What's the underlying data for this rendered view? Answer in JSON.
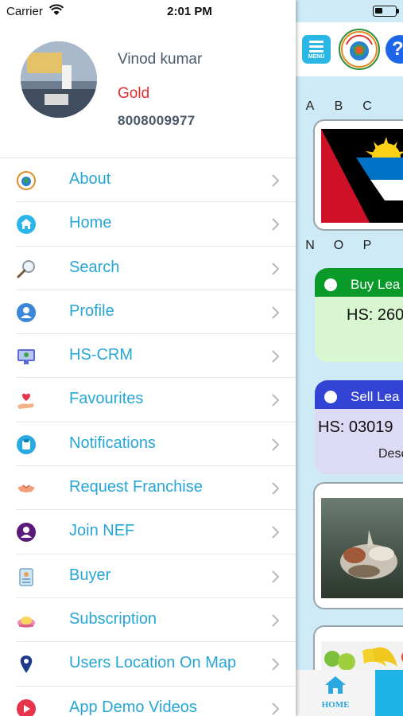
{
  "status_bar": {
    "carrier": "Carrier",
    "time": "2:01 PM"
  },
  "profile": {
    "name": "Vinod kumar",
    "tier": "Gold",
    "phone": "8008009977"
  },
  "menu": [
    {
      "label": "About",
      "icon": "about-icon"
    },
    {
      "label": "Home",
      "icon": "home-icon"
    },
    {
      "label": "Search",
      "icon": "search-icon"
    },
    {
      "label": "Profile",
      "icon": "profile-icon"
    },
    {
      "label": "HS-CRM",
      "icon": "crm-monitor-icon"
    },
    {
      "label": "Favourites",
      "icon": "heart-hand-icon"
    },
    {
      "label": "Notifications",
      "icon": "notification-icon"
    },
    {
      "label": "Request Franchise",
      "icon": "handshake-icon"
    },
    {
      "label": "Join NEF",
      "icon": "join-user-icon"
    },
    {
      "label": "Buyer",
      "icon": "buyer-id-icon"
    },
    {
      "label": "Subscription",
      "icon": "subscription-icon"
    },
    {
      "label": "Users Location On Map",
      "icon": "map-pin-icon"
    },
    {
      "label": "App Demo Videos",
      "icon": "play-icon"
    }
  ],
  "main": {
    "menu_button_label": "MENU",
    "help_button_label": "?",
    "alphabet_row_1": [
      "A",
      "B",
      "C"
    ],
    "alphabet_row_2": [
      "N",
      "O",
      "P"
    ],
    "buy_lead": {
      "title": "Buy Lea",
      "hs": "HS: 260"
    },
    "sell_lead": {
      "title": "Sell Lea",
      "hs": "HS: 03019",
      "desc": "Desc :"
    },
    "tab_home_label": "HOME"
  },
  "colors": {
    "menu_text": "#27a6d6",
    "tier_text": "#e52d2d",
    "buy_lead_header": "#0a9a2a",
    "sell_lead_header": "#3344d4",
    "main_background": "#cdeaf6"
  }
}
